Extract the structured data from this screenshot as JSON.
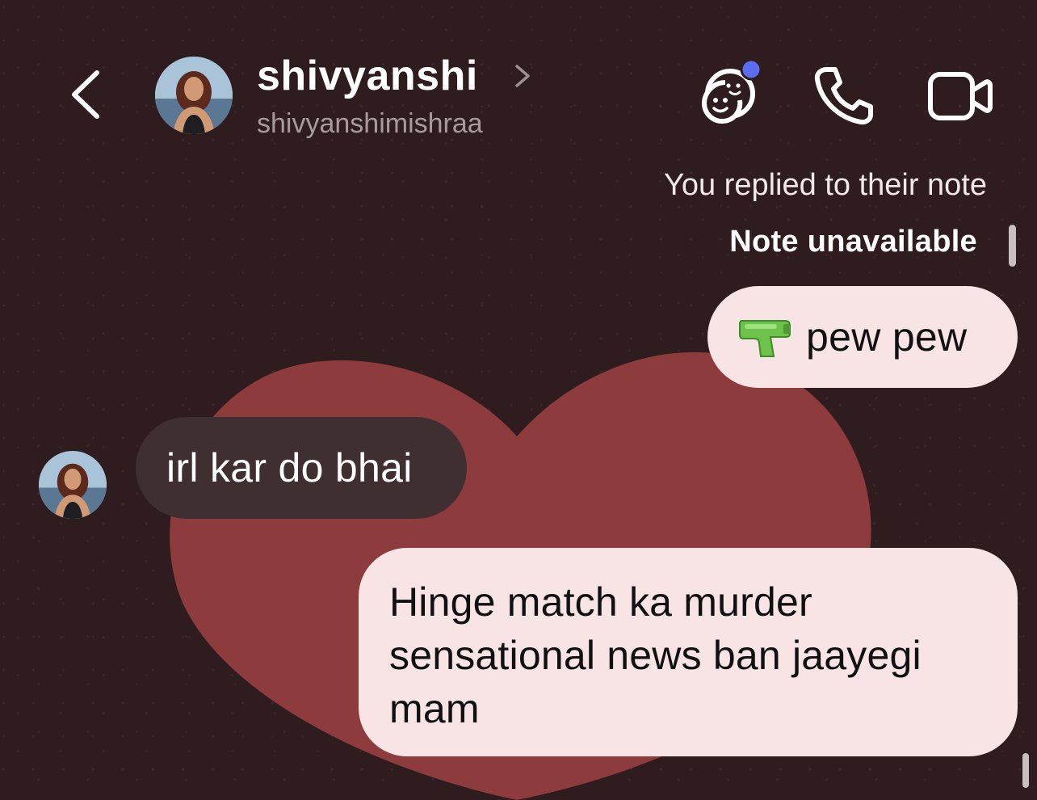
{
  "header": {
    "contact_name": "shivyanshi",
    "contact_handle": "shivyanshimishraa",
    "icons": {
      "back": "chevron-left-icon",
      "profile_chevron": "chevron-right-icon",
      "theme": "chat-theme-icon",
      "call": "phone-icon",
      "video": "video-camera-icon"
    },
    "theme_badge_color": "#5b6cf0"
  },
  "note_reply": {
    "label": "You replied to their note",
    "status": "Note unavailable"
  },
  "messages": [
    {
      "direction": "outgoing",
      "emoji": "water-pistol-icon",
      "text": "pew pew"
    },
    {
      "direction": "incoming",
      "text": "irl kar do bhai"
    },
    {
      "direction": "outgoing",
      "text": "Hinge match ka murder sensational news ban jaayegi mam"
    }
  ],
  "colors": {
    "background": "#2e1c1e",
    "heart": "#8e3b3d",
    "outgoing_bubble": "#f9e4e5",
    "incoming_bubble": "#3f2f30"
  }
}
